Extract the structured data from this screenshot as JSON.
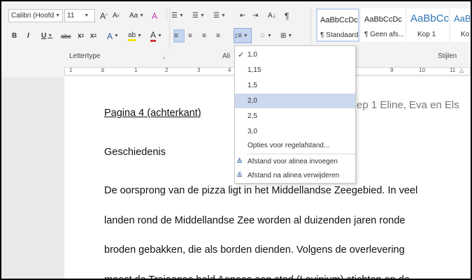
{
  "ribbon": {
    "font_name": "Calibri (Hoofd",
    "font_size": "11",
    "grow_font": "A",
    "shrink_font": "A",
    "change_case": "Aa",
    "clear_format": "A",
    "bold": "B",
    "italic": "I",
    "underline": "U",
    "strike": "abc",
    "subscript": "x",
    "superscript": "x",
    "text_effects": "A",
    "highlight": "ab",
    "font_color": "A",
    "sort": "A↓",
    "pilcrow": "¶",
    "group_font": "Lettertype",
    "group_paragraph": "Ali",
    "group_styles": "Stijlen",
    "styles": [
      {
        "preview": "AaBbCcDc",
        "name": "¶ Standaard"
      },
      {
        "preview": "AaBbCcDc",
        "name": "¶ Geen afs..."
      },
      {
        "preview": "AaBbCc",
        "name": "Kop 1"
      },
      {
        "preview": "AaBb",
        "name": "Kop"
      }
    ]
  },
  "ruler": {
    "numbers": [
      "1",
      "1",
      "2",
      "3",
      "4",
      "9",
      "10",
      "11"
    ]
  },
  "menu": {
    "items": [
      "1,0",
      "1,15",
      "1,5",
      "2,0",
      "2,5",
      "3,0"
    ],
    "checked_index": 0,
    "highlighted_index": 3,
    "more_options": "Opties voor regelafstand...",
    "add_space_before": "Afstand voor alinea invoegen",
    "remove_space_after": "Afstand na alinea verwijderen"
  },
  "document": {
    "heading_right": "ep 1 Eline, Eva en Els",
    "page_title": "Pagina 4 (achterkant)",
    "section": "Geschiedenis",
    "lines": [
      "De oorsprong van de pizza ligt in het Middellandse Zeegebied. In veel",
      "landen rond de Middellandse Zee worden al duizenden jaren ronde",
      "broden gebakken, die als borden dienden. Volgens de overlevering",
      "moest de Trojaanse held Aeneas een stad (Lavinium) stichten op de"
    ]
  },
  "colors": {
    "accent": "#2b579a",
    "highlight_yellow": "#f2e600",
    "font_red": "#d13438",
    "menu_highlight": "#cdd9ef"
  }
}
